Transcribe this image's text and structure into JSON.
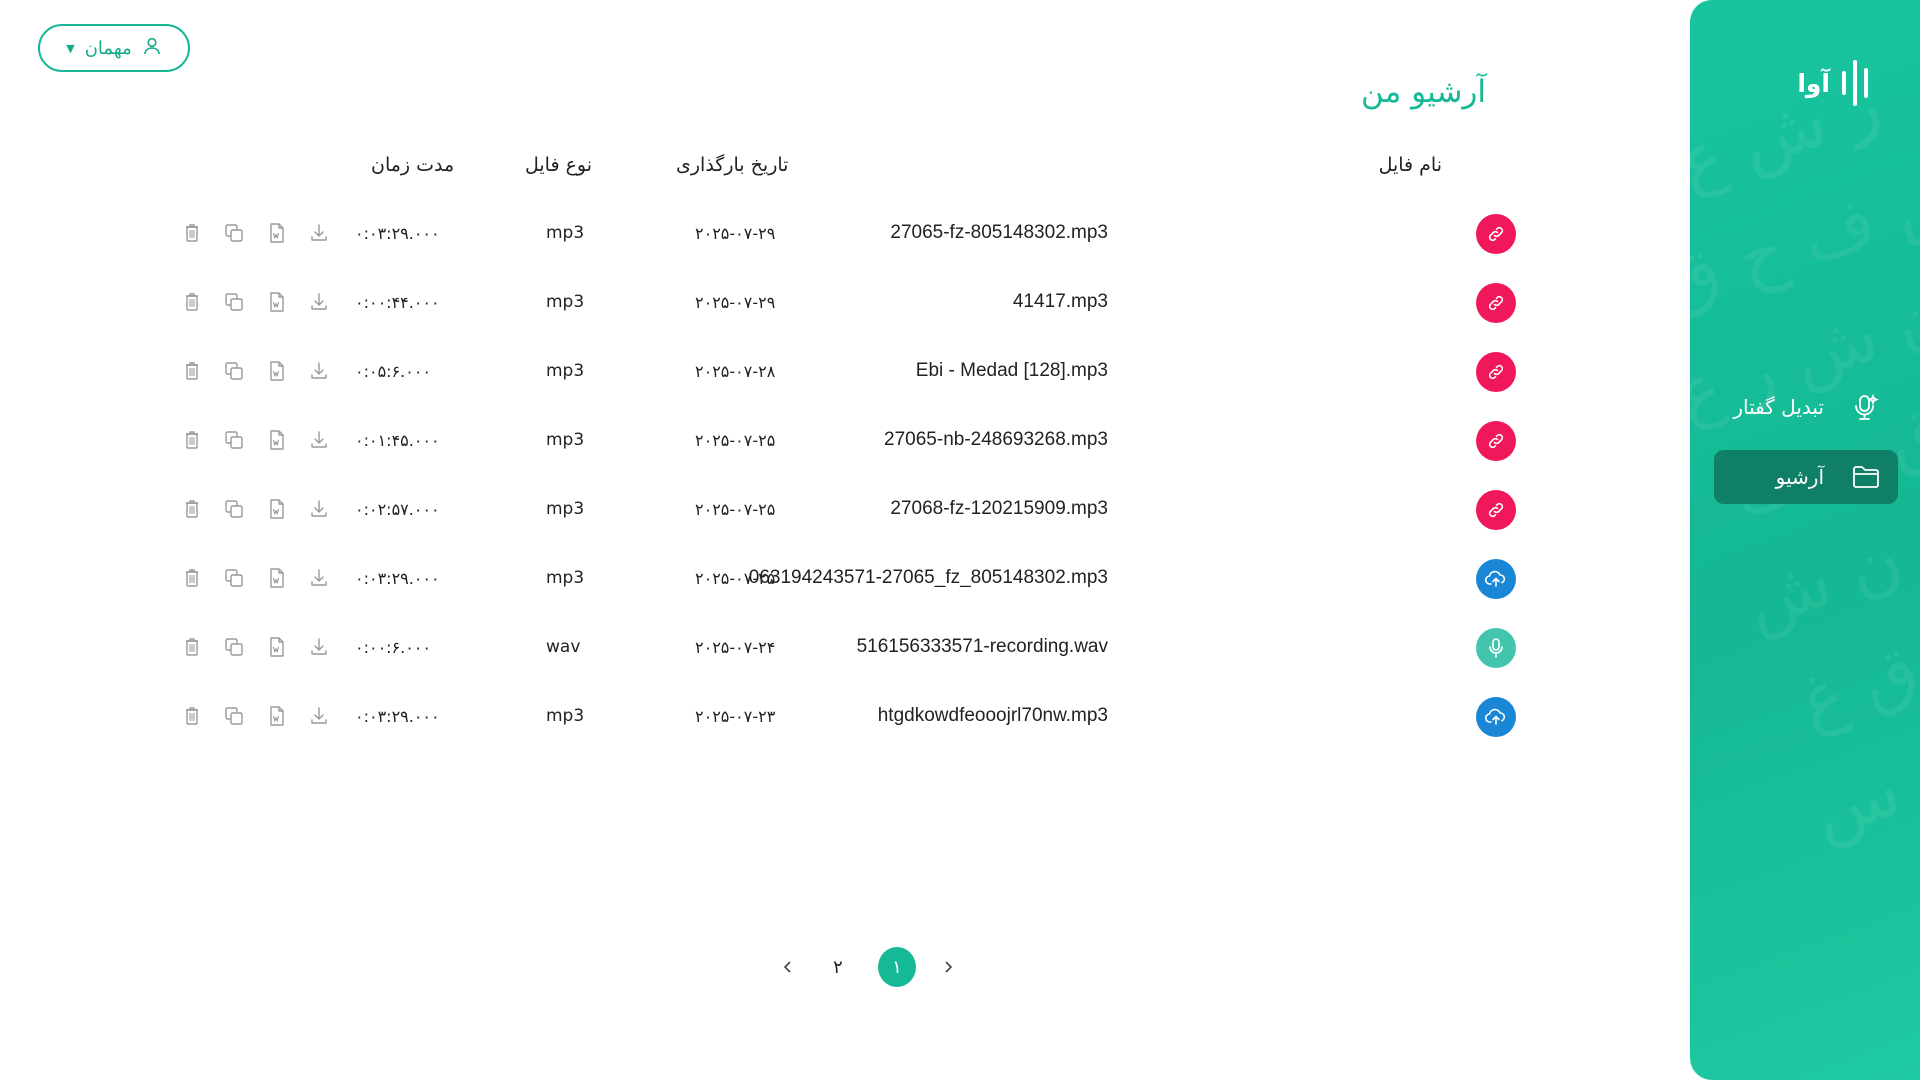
{
  "brand": {
    "name": "آوا"
  },
  "sidebar": {
    "items": [
      {
        "label": "تبدیل گفتار",
        "icon": "mic-ai-icon",
        "active": false
      },
      {
        "label": "آرشیو",
        "icon": "folder-icon",
        "active": true
      }
    ]
  },
  "user": {
    "label": "مهمان",
    "icon": "user-icon"
  },
  "page": {
    "title": "آرشیو من"
  },
  "table": {
    "headers": {
      "file_name": "نام فایل",
      "upload_date": "تاریخ بارگذاری",
      "file_type": "نوع فایل",
      "duration": "مدت زمان"
    },
    "rows": [
      {
        "name": "27065-fz-805148302.mp3",
        "source": "link",
        "date": "۲۰۲۵-۰۷-۲۹",
        "type": "mp3",
        "duration": "۰:۰۳:۲۹.۰۰۰"
      },
      {
        "name": "41417.mp3",
        "source": "link",
        "date": "۲۰۲۵-۰۷-۲۹",
        "type": "mp3",
        "duration": "۰:۰۰:۴۴.۰۰۰"
      },
      {
        "name": "Ebi - Medad [128].mp3",
        "source": "link",
        "date": "۲۰۲۵-۰۷-۲۸",
        "type": "mp3",
        "duration": "۰:۰۵:۶.۰۰۰"
      },
      {
        "name": "27065-nb-248693268.mp3",
        "source": "link",
        "date": "۲۰۲۵-۰۷-۲۵",
        "type": "mp3",
        "duration": "۰:۰۱:۴۵.۰۰۰"
      },
      {
        "name": "27068-fz-120215909.mp3",
        "source": "link",
        "date": "۲۰۲۵-۰۷-۲۵",
        "type": "mp3",
        "duration": "۰:۰۲:۵۷.۰۰۰"
      },
      {
        "name": "063194243571-27065_fz_805148302.mp3",
        "source": "upload",
        "date": "۲۰۲۵-۰۷-۲۵",
        "type": "mp3",
        "duration": "۰:۰۳:۲۹.۰۰۰"
      },
      {
        "name": "516156333571-recording.wav",
        "source": "record",
        "date": "۲۰۲۵-۰۷-۲۴",
        "type": "wav",
        "duration": "۰:۰۰:۶.۰۰۰"
      },
      {
        "name": "htgdkowdfeooojrl70nw.mp3",
        "source": "upload",
        "date": "۲۰۲۵-۰۷-۲۳",
        "type": "mp3",
        "duration": "۰:۰۳:۲۹.۰۰۰"
      }
    ],
    "row_actions": [
      "download-icon",
      "word-file-icon",
      "copy-icon",
      "delete-icon"
    ]
  },
  "pagination": {
    "pages": [
      "۱",
      "۲"
    ],
    "current": "۱"
  },
  "colors": {
    "accent": "#16b996",
    "sidebar_active": "#0f7f67",
    "link_source": "#f0185a",
    "upload_source": "#1a87d6",
    "record_source": "#42c5ac"
  }
}
